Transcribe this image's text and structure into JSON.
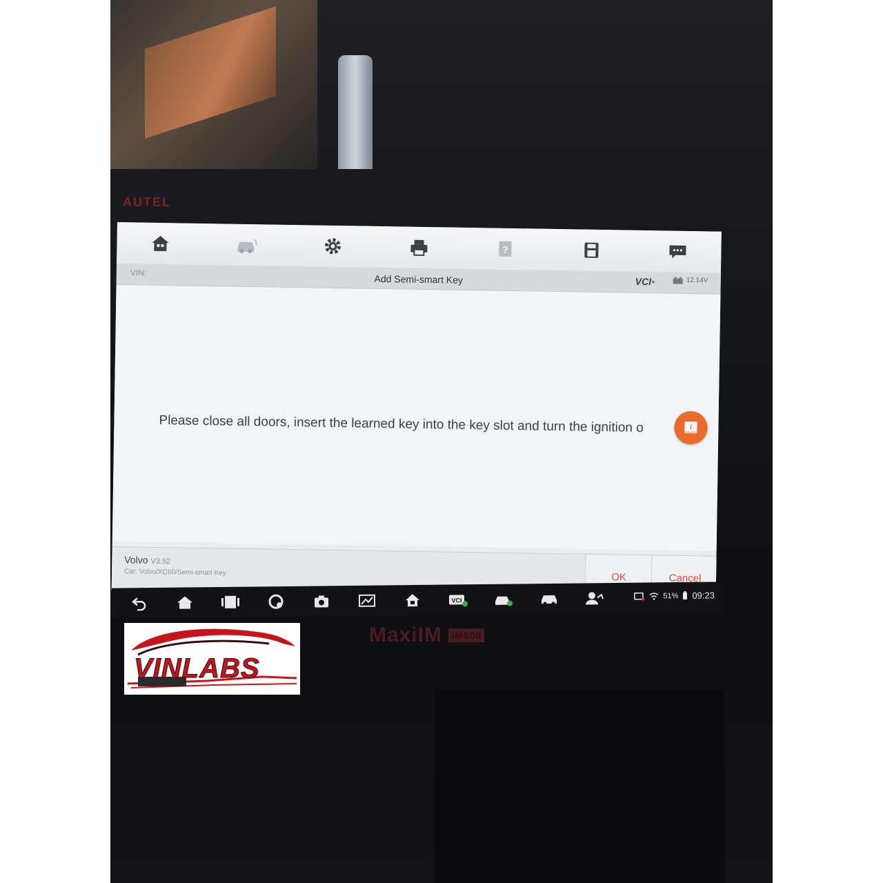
{
  "device": {
    "brand": "AUTEL",
    "model": "MaxiIM",
    "model_badge": "IM508"
  },
  "screen": {
    "toolbar": [
      "home-icon",
      "vehicle-icon",
      "settings-icon",
      "print-icon",
      "help-icon",
      "save-icon",
      "message-icon"
    ],
    "vin_label": "VIN:",
    "title": "Add Semi-smart Key",
    "vci": "VCI",
    "battery_voltage": "12.14V",
    "message": "Please close all doors, insert the learned key into the key slot and turn the ignition o",
    "footer": {
      "system": "Volvo",
      "version": "V3.52",
      "path": "Car: Volvo/XC60/Semi-smart Key",
      "ok_label": "OK",
      "cancel_label": "Cancel"
    }
  },
  "navbar": {
    "battery_pct": "51%",
    "time": "09:23"
  },
  "watermark": {
    "text": "VINLABS"
  },
  "colors": {
    "accent_orange": "#e96b2b",
    "button_text": "#e2503a",
    "logo_red": "#c4151c"
  }
}
